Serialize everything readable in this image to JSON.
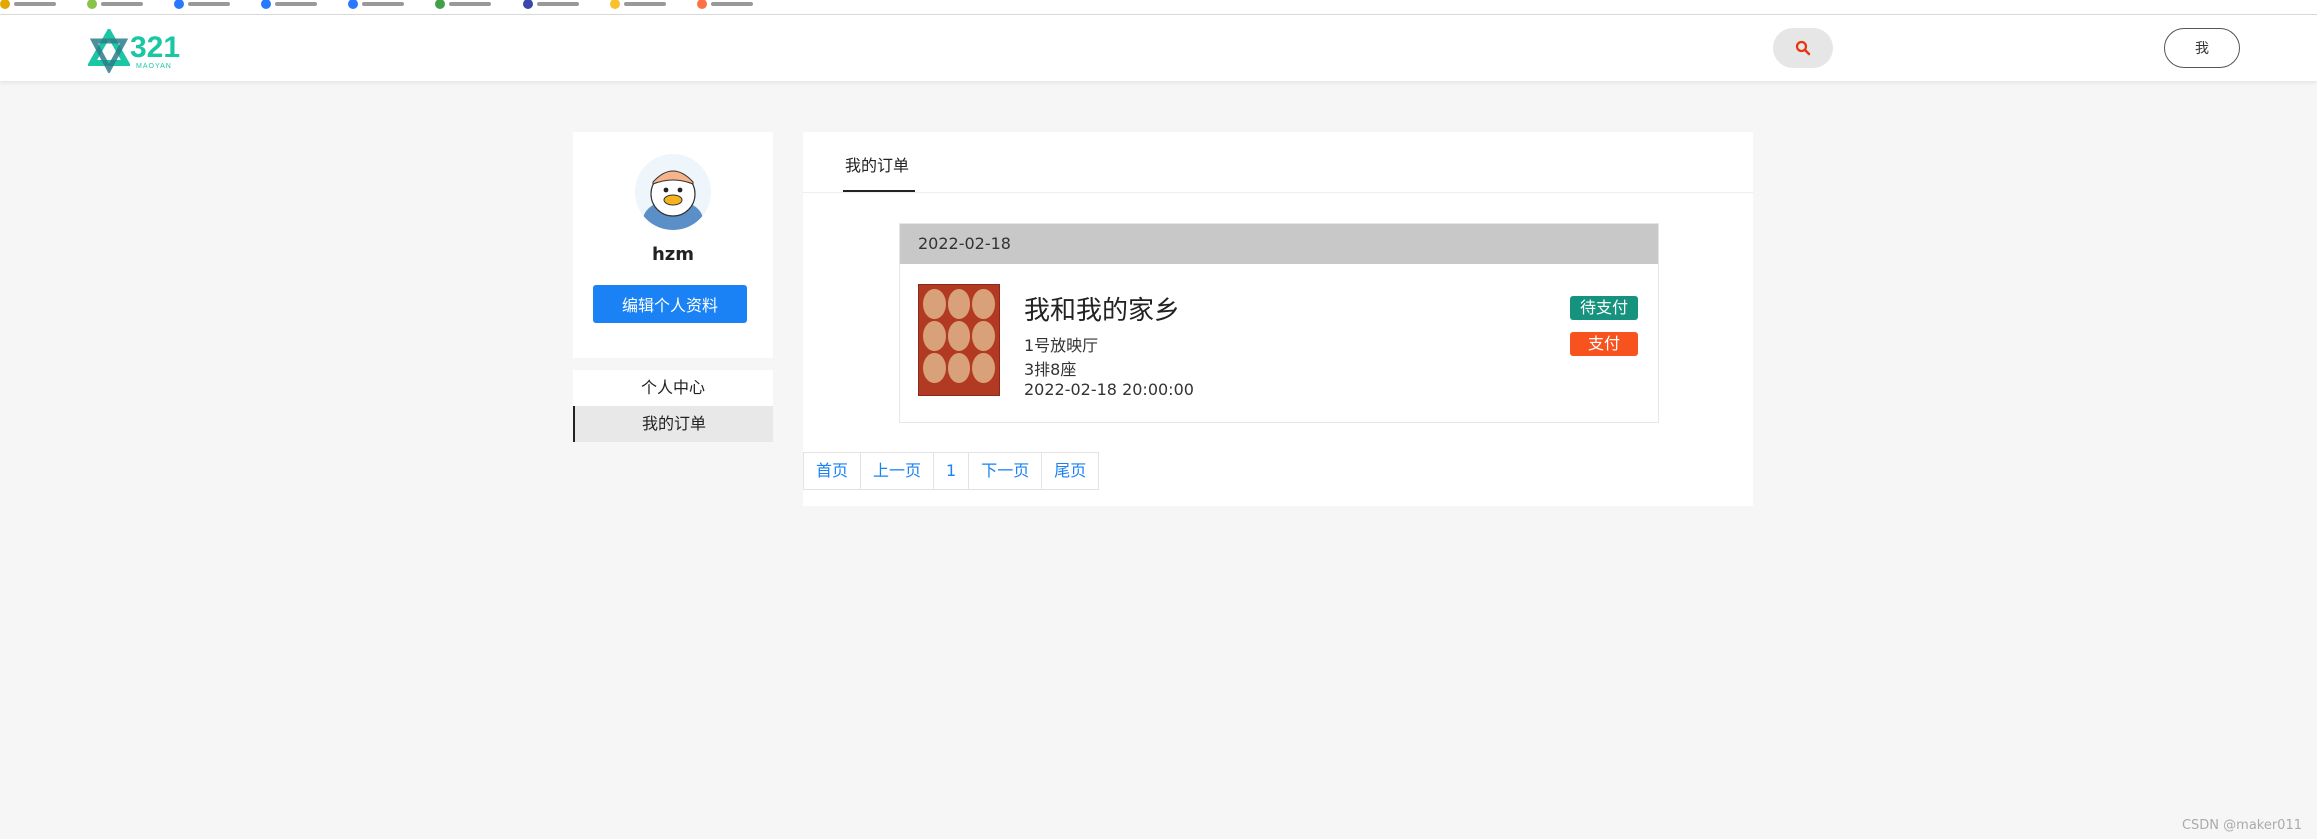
{
  "colors": {
    "accent": "#1a82f4",
    "logo": "#1bc6a4",
    "badge_wait": "#15937f",
    "badge_pay": "#f8531f",
    "date_bar": "#c8c8c8"
  },
  "header": {
    "logo_text": "321",
    "logo_sub": "MAOYAN",
    "search_icon": "search-icon",
    "me_label": "我"
  },
  "profile": {
    "username": "hzm",
    "edit_label": "编辑个人资料"
  },
  "sidebar": {
    "items": [
      {
        "label": "个人中心",
        "active": false
      },
      {
        "label": "我的订单",
        "active": true
      }
    ]
  },
  "main": {
    "tab_label": "我的订单",
    "order": {
      "date": "2022-02-18",
      "movie": "我和我的家乡",
      "hall": "1号放映厅",
      "seat": "3排8座",
      "showtime": "2022-02-18 20:00:00",
      "status": "待支付",
      "pay_label": "支付"
    },
    "pagination": [
      "首页",
      "上一页",
      "1",
      "下一页",
      "尾页"
    ]
  },
  "watermark": "CSDN @maker011"
}
